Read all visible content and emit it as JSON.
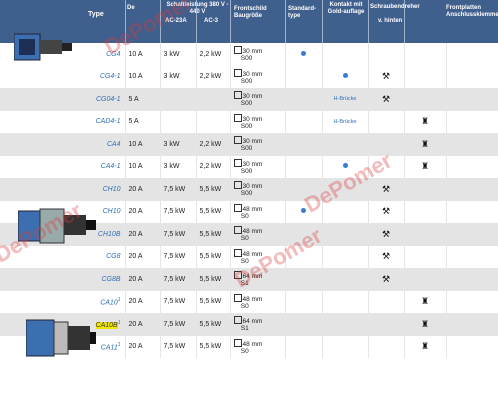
{
  "headers": {
    "type": "Type",
    "rated_current": "De",
    "power_ac23": "AC-23A",
    "power_title": "Schaltleistung 380 V - 440 V",
    "power_ac3": "AC-3",
    "front_plate": "Frontschild Baugröße",
    "standard_type": "Standard-type",
    "contact": "Kontakt mit Gold-auflage",
    "screwdriver": "Schraubendreher",
    "screwdriver_sub": "v. hinten",
    "terminal": "Frontplatten Anschlussklemmen"
  },
  "rows": [
    {
      "type": "CG4",
      "current": "10 A",
      "ac23": "3 kW",
      "ac3": "2,2 kW",
      "plate": "30 mm",
      "plate2": "S00",
      "std": true,
      "gold": "",
      "tool": false,
      "mount": false,
      "shaded": false
    },
    {
      "type": "CG4-1",
      "current": "10 A",
      "ac23": "3 kW",
      "ac3": "2,2 kW",
      "plate": "30 mm",
      "plate2": "S00",
      "std": false,
      "gold": "dot",
      "tool": true,
      "mount": false,
      "shaded": false
    },
    {
      "type": "CG04-1",
      "current": "5 A",
      "ac23": "",
      "ac3": "",
      "plate": "30 mm",
      "plate2": "S00",
      "std": false,
      "gold": "H-Brücke",
      "tool": true,
      "mount": false,
      "shaded": true
    },
    {
      "type": "CAD4-1",
      "current": "5 A",
      "ac23": "",
      "ac3": "",
      "plate": "30 mm",
      "plate2": "S00",
      "std": false,
      "gold": "H-Brücke",
      "tool": false,
      "mount": true,
      "shaded": false
    },
    {
      "type": "CA4",
      "current": "10 A",
      "ac23": "3 kW",
      "ac3": "2,2 kW",
      "plate": "30 mm",
      "plate2": "S00",
      "std": false,
      "gold": "",
      "tool": false,
      "mount": true,
      "shaded": true
    },
    {
      "type": "CA4-1",
      "current": "10 A",
      "ac23": "3 kW",
      "ac3": "2,2 kW",
      "plate": "30 mm",
      "plate2": "S00",
      "std": false,
      "gold": "dot",
      "tool": false,
      "mount": true,
      "shaded": false
    },
    {
      "type": "CH10",
      "current": "20 A",
      "ac23": "7,5 kW",
      "ac3": "5,5 kW",
      "plate": "30 mm",
      "plate2": "S00",
      "std": false,
      "gold": "",
      "tool": true,
      "mount": false,
      "shaded": true
    },
    {
      "type": "CH10",
      "current": "20 A",
      "ac23": "7,5 kW",
      "ac3": "5,5 kW",
      "plate": "48 mm",
      "plate2": "S0",
      "std": true,
      "gold": "",
      "tool": true,
      "mount": false,
      "shaded": false
    },
    {
      "type": "CH10B",
      "current": "20 A",
      "ac23": "7,5 kW",
      "ac3": "5,5 kW",
      "plate": "48 mm",
      "plate2": "S0",
      "std": false,
      "gold": "",
      "tool": true,
      "mount": false,
      "shaded": true
    },
    {
      "type": "CG8",
      "current": "20 A",
      "ac23": "7,5 kW",
      "ac3": "5,5 kW",
      "plate": "48 mm",
      "plate2": "S0",
      "std": false,
      "gold": "",
      "tool": true,
      "mount": false,
      "shaded": false
    },
    {
      "type": "CG8B",
      "current": "20 A",
      "ac23": "7,5 kW",
      "ac3": "5,5 kW",
      "plate": "64 mm",
      "plate2": "S1",
      "std": false,
      "gold": "",
      "tool": true,
      "mount": false,
      "shaded": true
    },
    {
      "type": "CA10",
      "sup": "1",
      "current": "20 A",
      "ac23": "7,5 kW",
      "ac3": "5,5 kW",
      "plate": "48 mm",
      "plate2": "S0",
      "std": false,
      "gold": "",
      "tool": false,
      "mount": true,
      "shaded": false
    },
    {
      "type": "CA10B",
      "sup": "1",
      "current": "20 A",
      "ac23": "7,5 kW",
      "ac3": "5,5 kW",
      "plate": "64 mm",
      "plate2": "S1",
      "std": false,
      "gold": "",
      "tool": false,
      "mount": true,
      "shaded": true,
      "highlight": true
    },
    {
      "type": "CA11",
      "sup": "1",
      "current": "20 A",
      "ac23": "7,5 kW",
      "ac3": "5,5 kW",
      "plate": "48 mm",
      "plate2": "S0",
      "std": false,
      "gold": "",
      "tool": false,
      "mount": true,
      "shaded": false
    }
  ],
  "watermark": "DePomer",
  "colors": {
    "header": "#3f5f8d",
    "type_link": "#2f6fb6",
    "dot": "#3a7bd5",
    "shade": "#e4e4e4"
  }
}
